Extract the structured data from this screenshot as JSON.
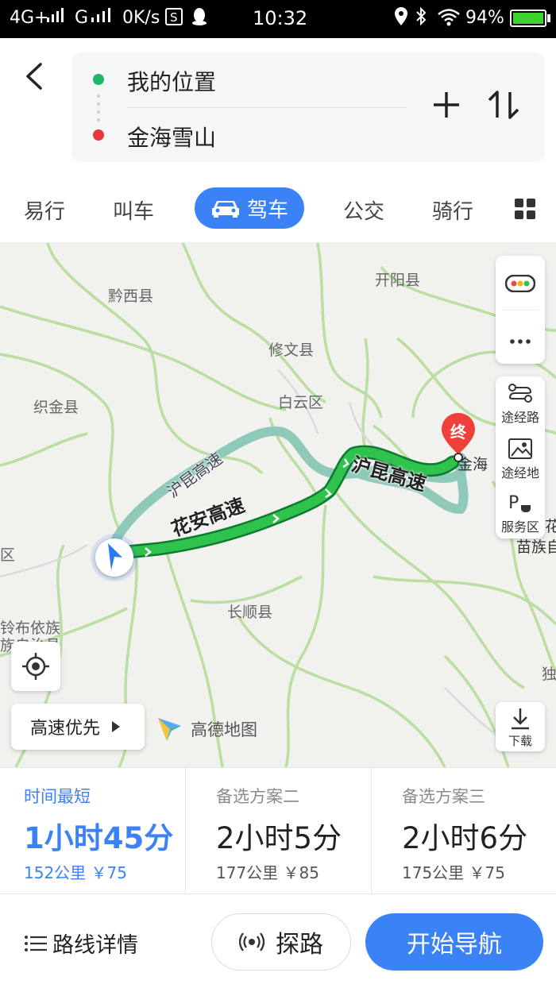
{
  "status_bar": {
    "network": "4G+",
    "network2": "G",
    "speed": "0K/s",
    "time": "10:32",
    "battery": "94%",
    "battery_level": 0.94
  },
  "route": {
    "start": "我的位置",
    "end": "金海雪山"
  },
  "tabs": [
    "易行",
    "叫车",
    "驾车",
    "公交",
    "骑行"
  ],
  "active_tab": "驾车",
  "map": {
    "places": {
      "qianxi": "黔西县",
      "kaiyang": "开阳县",
      "xiuwen": "修文县",
      "zhijin": "织金县",
      "baiyun": "白云区",
      "changshun": "长顺县",
      "jinhai": "金海",
      "ziyun1": "铃布依族",
      "ziyun2": "族自治县",
      "qu": "区",
      "du": "独",
      "miao": "苗族自",
      "hua": "花"
    },
    "roads": {
      "primary": "花安高速",
      "alt": "沪昆高速",
      "alt2": "沪昆高速"
    },
    "end_marker": "终",
    "tools": {
      "via_road": "途经路",
      "via_place": "途经地",
      "service_area": "服务区",
      "download": "下载"
    },
    "preference": "高速优先",
    "logo_text": "高德地图"
  },
  "options": [
    {
      "label": "时间最短",
      "time": "1小时45分",
      "meta": "152公里 ￥75"
    },
    {
      "label": "备选方案二",
      "time": "2小时5分",
      "meta": "177公里 ￥85"
    },
    {
      "label": "备选方案三",
      "time": "2小时6分",
      "meta": "175公里 ￥75"
    }
  ],
  "bottom": {
    "detail": "路线详情",
    "probe": "探路",
    "start_nav": "开始导航"
  },
  "colors": {
    "accent": "#3b82f6",
    "route_green": "#1aa34a",
    "alt_route": "#8fc9b9",
    "start_dot": "#1fb86b",
    "end_dot": "#e8383d"
  }
}
